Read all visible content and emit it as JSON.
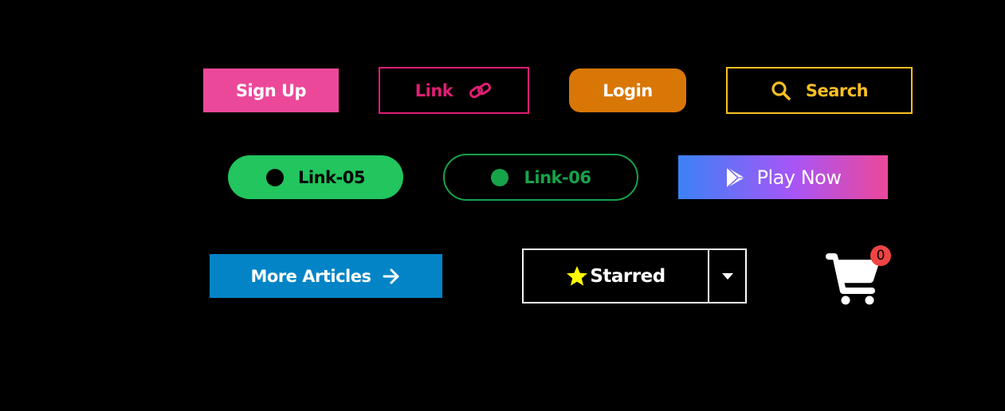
{
  "buttons": {
    "signup": {
      "label": "Sign Up"
    },
    "link": {
      "label": "Link",
      "icon": "link-icon"
    },
    "login": {
      "label": "Login"
    },
    "search": {
      "label": "Search",
      "icon": "search-icon"
    },
    "link05": {
      "label": "Link-05"
    },
    "link06": {
      "label": "Link-06"
    },
    "play": {
      "label": "Play Now",
      "icon": "play-store-icon"
    },
    "more_articles": {
      "label": "More Articles",
      "icon": "arrow-right-icon"
    },
    "starred": {
      "label": "Starred",
      "icon": "star-icon",
      "dropdown_icon": "caret-down-icon"
    }
  },
  "cart": {
    "icon": "shopping-cart-icon",
    "count": "0"
  },
  "colors": {
    "background": "#000000",
    "pink": "#ec4899",
    "crimson": "#e11d74",
    "orange": "#d97706",
    "amber": "#fbbf24",
    "green": "#22c55e",
    "green_dark": "#16a34a",
    "blue": "#0284c7",
    "star": "#ffff00",
    "badge": "#ef4444"
  }
}
